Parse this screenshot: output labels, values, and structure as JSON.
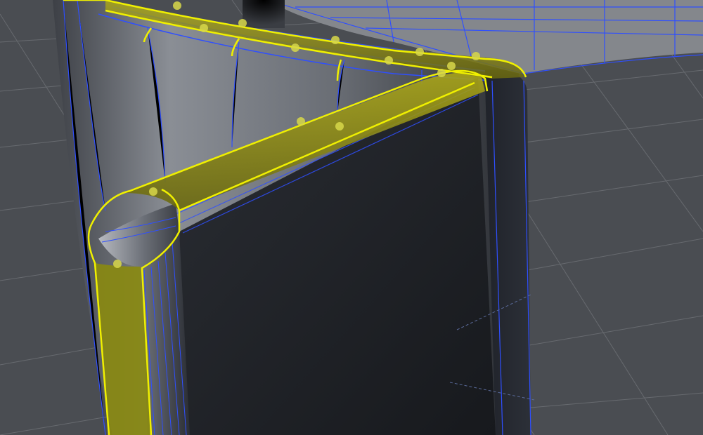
{
  "viewport": {
    "view_name": "3d-viewport",
    "colors": {
      "background": "#4a4d52",
      "grid_line": "#6b6e73",
      "wireframe": "#2f4fff",
      "selection": "#f0f000",
      "selection_fill": "#8a8a10",
      "vertex_point": "#d8d84a",
      "mesh_dark": "#1e2126",
      "mesh_mid": "#5f636a",
      "mesh_light": "#8d9197"
    },
    "scene": {
      "object": "beveled-wall-mesh",
      "selected_element": "bevel-edge-loop"
    }
  }
}
